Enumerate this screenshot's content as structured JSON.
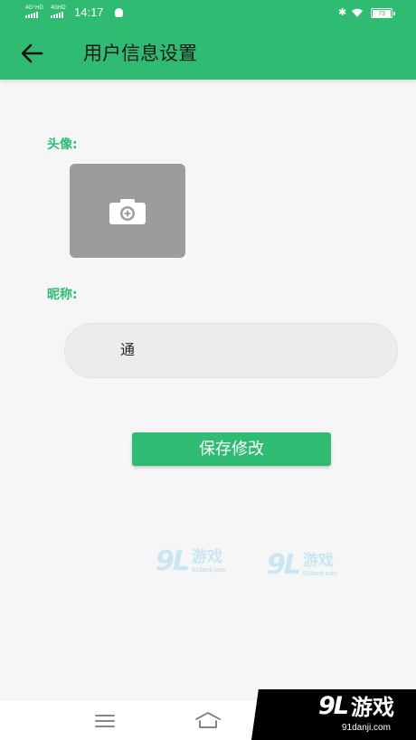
{
  "status_bar": {
    "signal_1": "4G⁺HD",
    "signal_2": "4GHD",
    "time": "14:17",
    "battery": "73"
  },
  "app_bar": {
    "title": "用户信息设置"
  },
  "form": {
    "avatar_label": "头像:",
    "nickname_label": "昵称:",
    "nickname_value": "通",
    "save_label": "保存修改"
  },
  "watermark": {
    "mark": "9L",
    "name": "游戏",
    "url": "91danji.com"
  },
  "colors": {
    "primary": "#2fbc72",
    "avatar_placeholder": "#9c9c9c",
    "input_bg": "#ececec"
  },
  "icons": {
    "back": "arrow-left-icon",
    "camera": "camera-icon",
    "menu": "menu-icon",
    "home": "home-icon"
  }
}
